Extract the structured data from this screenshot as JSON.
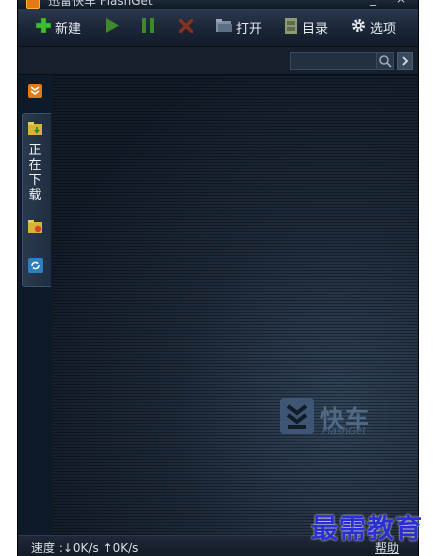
{
  "window": {
    "title": "迅雷快车 FlashGet",
    "controls": [
      "_",
      "×"
    ]
  },
  "toolbar": {
    "new_label": "新建",
    "open_label": "打开",
    "directory_label": "目录",
    "options_label": "选项"
  },
  "search": {
    "value": "",
    "placeholder": ""
  },
  "sidebar": {
    "downloading_tab_chars": [
      "正",
      "在",
      "下",
      "载"
    ]
  },
  "watermark": {
    "name_cn": "快车",
    "name_en": "FlashGet"
  },
  "statusbar": {
    "speed_text": "速度 :↓0K/s ↑0K/s",
    "help_label": "帮助"
  },
  "corner_brand": {
    "text": "最需教育"
  },
  "colors": {
    "new_icon": "#3fbf2f",
    "start_icon": "#3d8a2a",
    "pause_icon": "#3d8a2a",
    "delete_icon": "#8a3020",
    "accent_orange": "#e47a16",
    "corner_brand": "#2b2fd0"
  }
}
